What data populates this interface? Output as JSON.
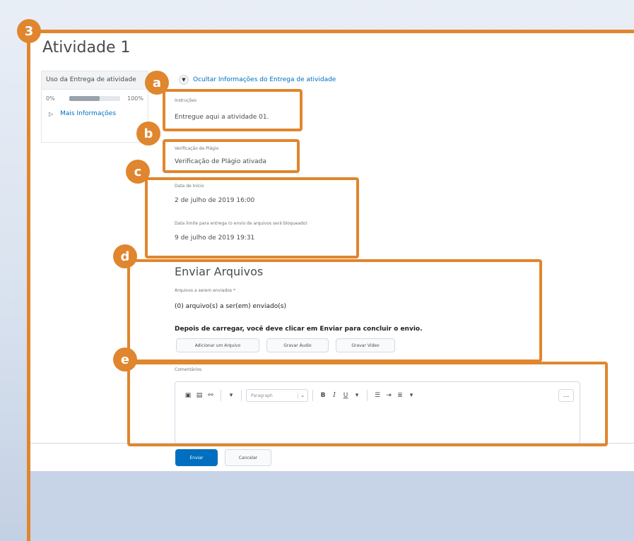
{
  "colors": {
    "accent": "#e0862e",
    "link": "#006fbf",
    "primary_button": "#006fbf"
  },
  "badges": {
    "frame": "3",
    "a": "a",
    "b": "b",
    "c": "c",
    "d": "d",
    "e": "e"
  },
  "page": {
    "title": "Atividade 1"
  },
  "side_panel": {
    "header": "Uso da Entrega de atividade",
    "progress_min": "0%",
    "progress_max": "100%",
    "progress_value": 0.6,
    "more_info": "Mais Informações"
  },
  "toggle": {
    "label": "Ocultar Informações do Entrega de atividade",
    "icon": "chevron-down-icon"
  },
  "instructions": {
    "label": "Instruções",
    "value": "Entregue aqui a atividade 01."
  },
  "plagiarism": {
    "label": "Verificação de Plágio",
    "value": "Verificação de Plágio ativada"
  },
  "dates": {
    "start_label": "Data de Início",
    "start_value": "2 de julho de 2019 16:00",
    "due_label": "Data limite para entrega (o envio de arquivos será bloqueado)",
    "due_value": "9 de julho de 2019 19:31"
  },
  "upload": {
    "heading": "Enviar Arquivos",
    "files_label": "Arquivos a serem enviados *",
    "files_value": "(0) arquivo(s) a ser(em) enviado(s)",
    "instruction": "Depois de carregar, você deve clicar em Enviar para concluir o envio.",
    "btn_add": "Adicionar um Arquivo",
    "btn_audio": "Gravar Áudio",
    "btn_video": "Gravar Vídeo"
  },
  "comments": {
    "label": "Comentários",
    "format_select": "Paragraph",
    "more": "..."
  },
  "actions": {
    "submit": "Enviar",
    "cancel": "Cancelar"
  }
}
